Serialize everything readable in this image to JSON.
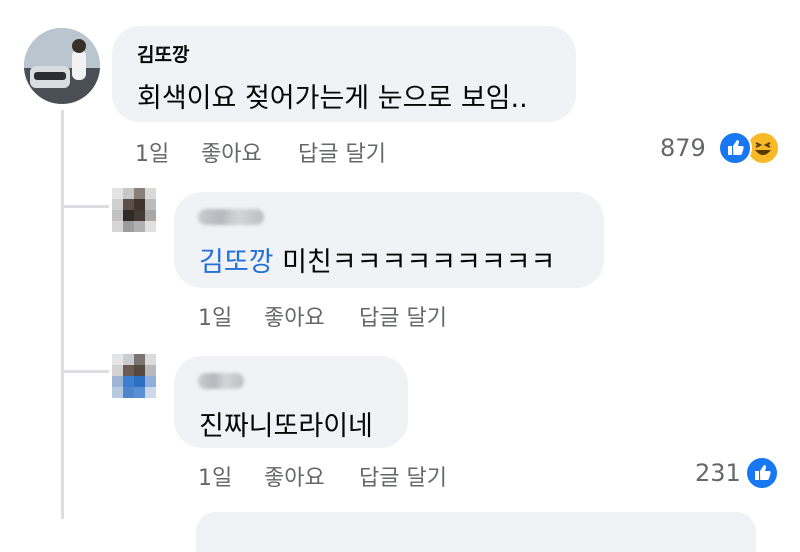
{
  "comments": [
    {
      "author": "김또깡",
      "text": "회색이요 젖어가는게 눈으로 보임..",
      "time": "1일",
      "like_label": "좋아요",
      "reply_label": "답글 달기",
      "reaction_count": "879",
      "reactions": [
        "like-icon",
        "haha-icon"
      ]
    }
  ],
  "replies": [
    {
      "author_blurred": true,
      "mention": "김또깡",
      "text": " 미친ㅋㅋㅋㅋㅋㅋㅋㅋㅋ",
      "time": "1일",
      "like_label": "좋아요",
      "reply_label": "답글 달기"
    },
    {
      "author_blurred": true,
      "text": "진짜니또라이네",
      "time": "1일",
      "like_label": "좋아요",
      "reply_label": "답글 달기",
      "reaction_count": "231",
      "reactions": [
        "like-icon"
      ]
    }
  ],
  "colors": {
    "bubble": "#f0f2f5",
    "mention": "#216fdb",
    "meta": "#65676b",
    "like": "#1877f2",
    "haha": "#f7b928"
  }
}
